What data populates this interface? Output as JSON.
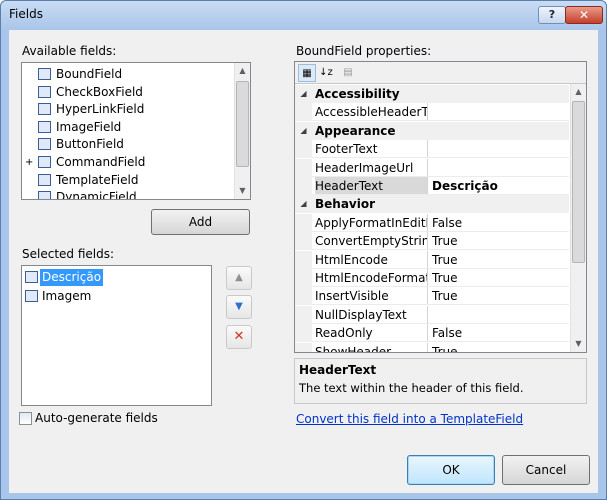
{
  "window": {
    "title": "Fields",
    "help_button": "?",
    "close_button": "✕"
  },
  "available": {
    "label": "Available fields:",
    "items": [
      {
        "label": "BoundField"
      },
      {
        "label": "CheckBoxField"
      },
      {
        "label": "HyperLinkField"
      },
      {
        "label": "ImageField"
      },
      {
        "label": "ButtonField"
      },
      {
        "label": "CommandField"
      },
      {
        "label": "TemplateField"
      },
      {
        "label": "DynamicField"
      }
    ],
    "add_button": "Add"
  },
  "selected": {
    "label": "Selected fields:",
    "items": [
      {
        "label": "Descrição",
        "selected": true
      },
      {
        "label": "Imagem",
        "selected": false
      }
    ]
  },
  "side_buttons": {
    "up": "▲",
    "down": "▼",
    "delete": "✕"
  },
  "properties": {
    "label": "BoundField properties:",
    "rows": [
      {
        "type": "category",
        "name": "Accessibility"
      },
      {
        "type": "prop",
        "name": "AccessibleHeaderTex",
        "value": ""
      },
      {
        "type": "category",
        "name": "Appearance"
      },
      {
        "type": "prop",
        "name": "FooterText",
        "value": ""
      },
      {
        "type": "prop",
        "name": "HeaderImageUrl",
        "value": ""
      },
      {
        "type": "prop",
        "name": "HeaderText",
        "value": "Descrição",
        "selected": true
      },
      {
        "type": "category",
        "name": "Behavior"
      },
      {
        "type": "prop",
        "name": "ApplyFormatInEditMo",
        "value": "False"
      },
      {
        "type": "prop",
        "name": "ConvertEmptyStringT",
        "value": "True"
      },
      {
        "type": "prop",
        "name": "HtmlEncode",
        "value": "True"
      },
      {
        "type": "prop",
        "name": "HtmlEncodeFormatSt",
        "value": "True"
      },
      {
        "type": "prop",
        "name": "InsertVisible",
        "value": "True"
      },
      {
        "type": "prop",
        "name": "NullDisplayText",
        "value": ""
      },
      {
        "type": "prop",
        "name": "ReadOnly",
        "value": "False"
      },
      {
        "type": "prop",
        "name": "ShowHeader",
        "value": "True"
      }
    ],
    "description": {
      "title": "HeaderText",
      "text": "The text within the header of this field."
    },
    "convert_link": "Convert this field into a TemplateField"
  },
  "autogen": {
    "label": "Auto-generate fields",
    "checked": false
  },
  "footer": {
    "ok": "OK",
    "cancel": "Cancel"
  },
  "colors": {
    "selection": "#3399ff",
    "title_bar": "#aac6ea",
    "close_button": "#c4402b",
    "link": "#0033cc"
  }
}
